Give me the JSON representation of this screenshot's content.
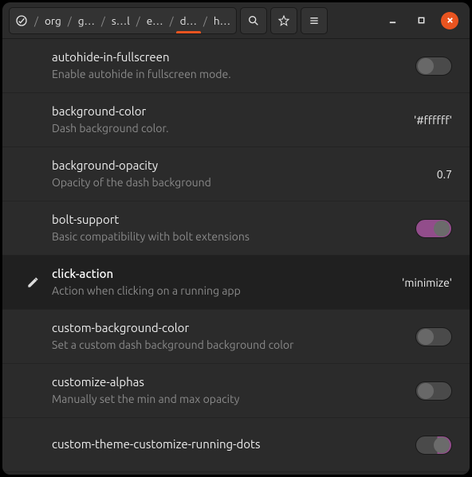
{
  "breadcrumb": {
    "segments": [
      "org",
      "g…",
      "s…l",
      "e…",
      "d…",
      "h…"
    ],
    "active_index": 4
  },
  "settings": [
    {
      "key": "autohide-in-fullscreen",
      "desc": "Enable autohide in fullscreen mode.",
      "type": "toggle",
      "value": false,
      "selected": false
    },
    {
      "key": "background-color",
      "desc": "Dash background color.",
      "type": "text",
      "value": "'#ffffff'",
      "selected": false
    },
    {
      "key": "background-opacity",
      "desc": "Opacity of the dash background",
      "type": "text",
      "value": "0.7",
      "selected": false
    },
    {
      "key": "bolt-support",
      "desc": "Basic compatibility with bolt extensions",
      "type": "toggle",
      "value": true,
      "selected": false
    },
    {
      "key": "click-action",
      "desc": "Action when clicking on a running app",
      "type": "text",
      "value": "'minimize'",
      "selected": true
    },
    {
      "key": "custom-background-color",
      "desc": "Set a custom dash background background color",
      "type": "toggle",
      "value": false,
      "selected": false
    },
    {
      "key": "customize-alphas",
      "desc": "Manually set the min and max opacity",
      "type": "toggle",
      "value": false,
      "selected": false
    },
    {
      "key": "custom-theme-customize-running-dots",
      "desc": "",
      "type": "toggle-partial",
      "value": true,
      "selected": false
    }
  ]
}
